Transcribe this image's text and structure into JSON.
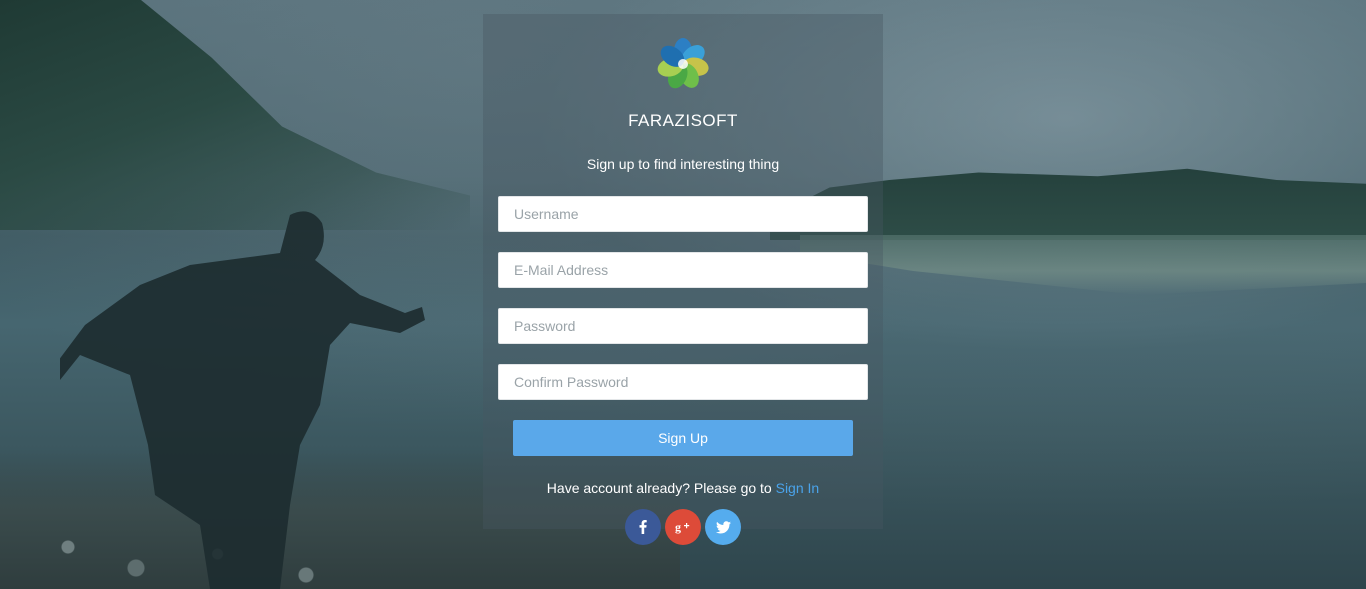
{
  "brand": {
    "name": "FARAZISOFT",
    "logo_icon": "flower-logo-icon"
  },
  "form": {
    "tagline": "Sign up to find interesting thing",
    "fields": [
      {
        "placeholder": "Username",
        "value": ""
      },
      {
        "placeholder": "E-Mail Address",
        "value": ""
      },
      {
        "placeholder": "Password",
        "value": ""
      },
      {
        "placeholder": "Confirm Password",
        "value": ""
      }
    ],
    "submit_label": "Sign Up",
    "have_account_text": "Have account already? Please go to ",
    "sign_in_link": "Sign In"
  },
  "social": [
    {
      "icon": "facebook-icon",
      "color": "#3b5998"
    },
    {
      "icon": "google-plus-icon",
      "color": "#dd4b39"
    },
    {
      "icon": "twitter-icon",
      "color": "#55acee"
    }
  ],
  "colors": {
    "accent": "#5aa8ea",
    "link": "#4aa3ea"
  }
}
